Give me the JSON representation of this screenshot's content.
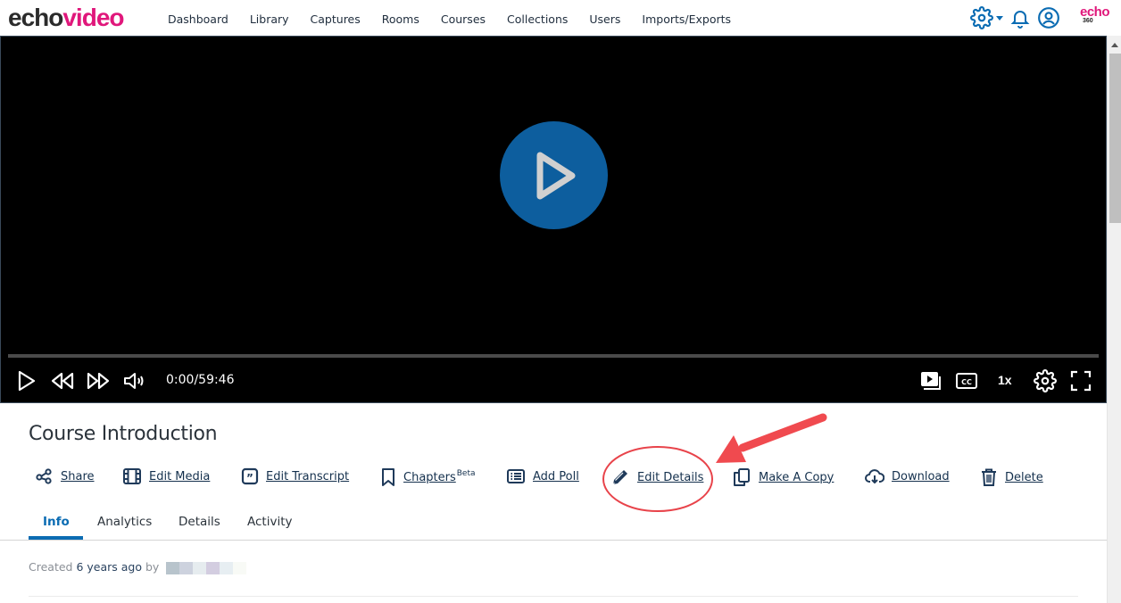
{
  "brand": {
    "logo_part1": "echo",
    "logo_part2": "video",
    "corner_logo_top": "echo",
    "corner_logo_bottom": "360"
  },
  "nav": {
    "items": [
      {
        "label": "Dashboard"
      },
      {
        "label": "Library"
      },
      {
        "label": "Captures"
      },
      {
        "label": "Rooms"
      },
      {
        "label": "Courses"
      },
      {
        "label": "Collections"
      },
      {
        "label": "Users"
      },
      {
        "label": "Imports/Exports"
      }
    ],
    "icons": [
      "gear-icon",
      "chevron-down-icon",
      "bell-icon",
      "user-circle-icon"
    ]
  },
  "player": {
    "current_time": "0:00",
    "duration": "59:46",
    "time_display": "0:00/59:46",
    "progress": 0,
    "speed": "1x",
    "accent": "#0d5e9e"
  },
  "media": {
    "title": "Course Introduction",
    "actions": [
      {
        "label": "Share",
        "icon": "share-icon"
      },
      {
        "label": "Edit Media",
        "icon": "film-icon"
      },
      {
        "label": "Edit Transcript",
        "icon": "quote-icon"
      },
      {
        "label": "Chapters",
        "badge": "Beta",
        "icon": "bookmark-icon"
      },
      {
        "label": "Add Poll",
        "icon": "list-icon"
      },
      {
        "label": "Edit Details",
        "icon": "pencil-icon"
      },
      {
        "label": "Make A Copy",
        "icon": "copy-icon"
      },
      {
        "label": "Download",
        "icon": "cloud-download-icon"
      },
      {
        "label": "Delete",
        "icon": "trash-icon"
      }
    ],
    "tabs": [
      {
        "label": "Info",
        "active": true
      },
      {
        "label": "Analytics"
      },
      {
        "label": "Details"
      },
      {
        "label": "Activity"
      }
    ],
    "created_prefix": "Created",
    "created_age": "6 years ago",
    "created_by": "by"
  },
  "annotation": {
    "color": "#e8434a",
    "target": "Edit Details"
  }
}
